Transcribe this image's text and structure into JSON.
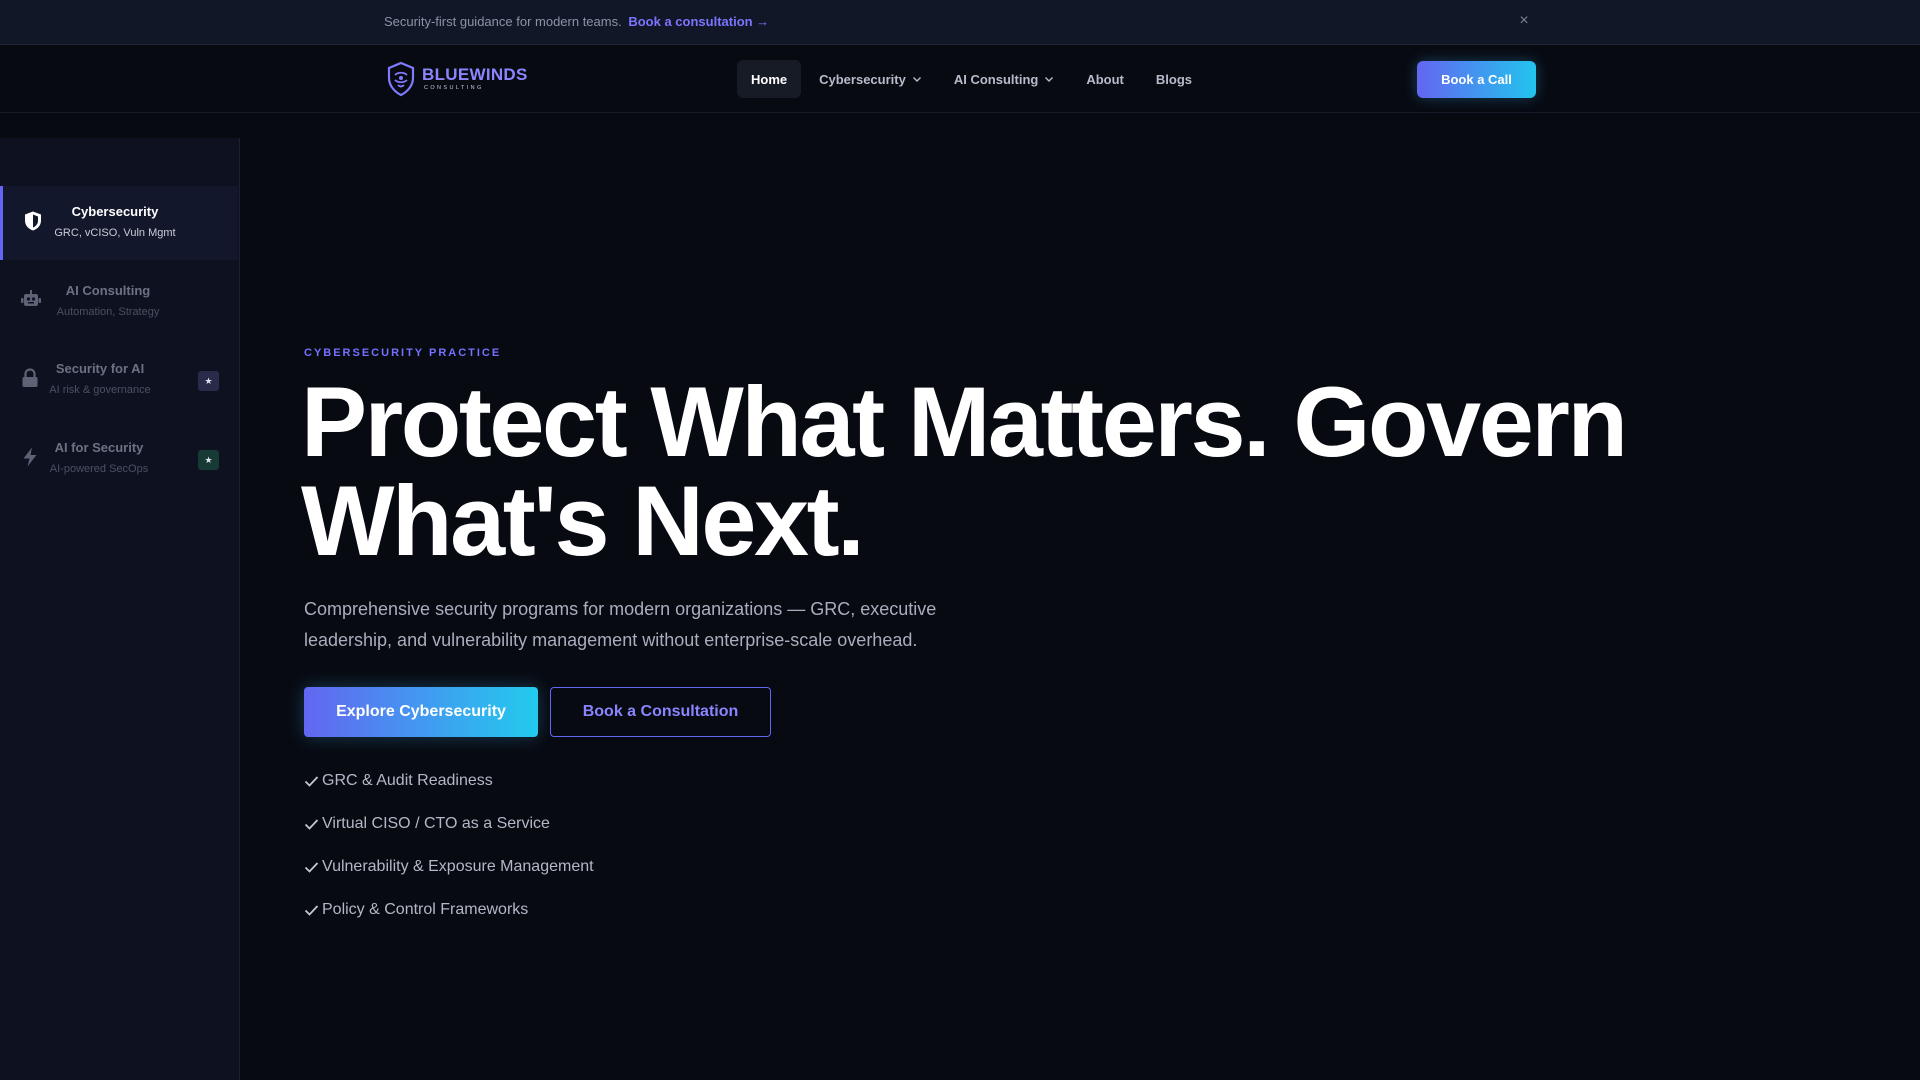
{
  "announcement": {
    "text": "Security-first guidance for modern teams.",
    "link": "Book a consultation →",
    "close": "×"
  },
  "header": {
    "logo": {
      "name": "BLUEWINDS",
      "tagline": "CONSULTING"
    },
    "nav": [
      {
        "label": "Home",
        "active": true
      },
      {
        "label": "Cybersecurity",
        "dropdown": true
      },
      {
        "label": "AI Consulting",
        "dropdown": true
      },
      {
        "label": "About"
      },
      {
        "label": "Blogs"
      }
    ],
    "cta": "Book a Call"
  },
  "sidebar": {
    "items": [
      {
        "title": "Cybersecurity",
        "subtitle": "GRC, vCISO, Vuln Mgmt",
        "icon": "shield-icon",
        "active": true
      },
      {
        "title": "AI Consulting",
        "subtitle": "Automation, Strategy",
        "icon": "robot-icon"
      },
      {
        "title": "Security for AI",
        "subtitle": "AI risk & governance",
        "icon": "lock-icon",
        "badge": "★"
      },
      {
        "title": "AI for Security",
        "subtitle": "AI-powered SecOps",
        "icon": "bolt-icon",
        "badge": "★"
      }
    ]
  },
  "hero": {
    "eyebrow": "CYBERSECURITY PRACTICE",
    "title_line1": "Protect What Matters. Govern",
    "title_line2": "What's Next.",
    "description": "Comprehensive security programs for modern organizations — GRC, executive leadership, and vulnerability management without enterprise-scale overhead.",
    "primary_button": "Explore Cybersecurity",
    "secondary_button": "Book a Consultation",
    "features": [
      "GRC & Audit Readiness",
      "Virtual CISO / CTO as a Service",
      "Vulnerability & Exposure Management",
      "Policy & Control Frameworks"
    ]
  },
  "colors": {
    "background": "#080a12",
    "accent": "#6366f1",
    "gradient_end": "#22c4ee",
    "text": "#ffffff",
    "muted": "#a8aebd"
  }
}
